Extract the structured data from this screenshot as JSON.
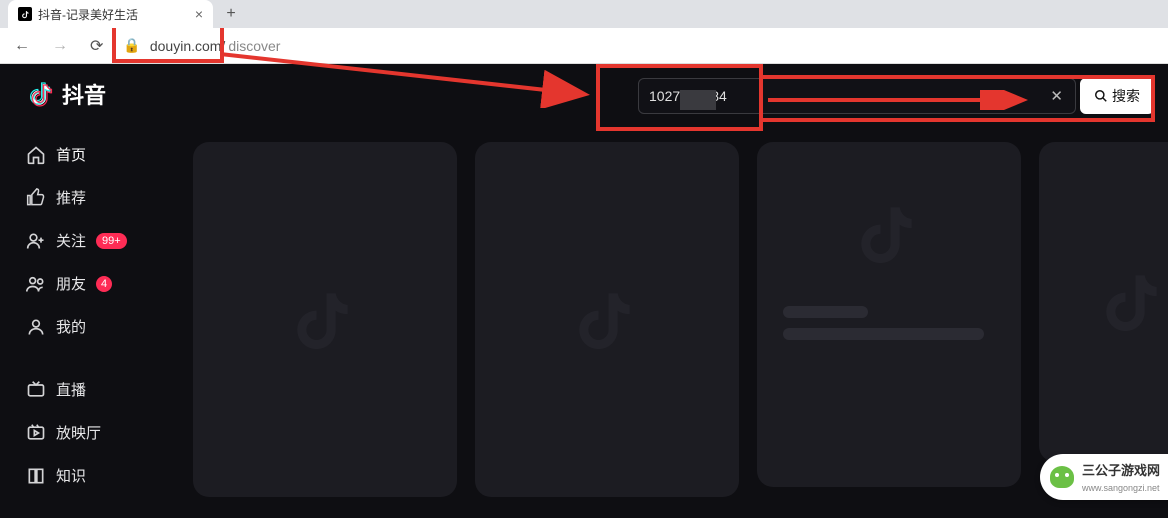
{
  "browser": {
    "tab_title": "抖音-记录美好生活",
    "url_domain": "douyin.com/",
    "url_path": "discover"
  },
  "app": {
    "logo_text": "抖音",
    "search_value_prefix": "1027",
    "search_value_suffix": "484",
    "search_button": "搜索"
  },
  "sidebar": {
    "items": [
      {
        "icon": "home",
        "label": "首页",
        "badge": null,
        "active": true
      },
      {
        "icon": "thumb",
        "label": "推荐",
        "badge": null
      },
      {
        "icon": "user-plus",
        "label": "关注",
        "badge": "99+"
      },
      {
        "icon": "people",
        "label": "朋友",
        "badge": "4",
        "badge_round": true
      },
      {
        "icon": "person",
        "label": "我的",
        "badge": null
      },
      {
        "sep": true
      },
      {
        "icon": "tv",
        "label": "直播",
        "badge": null
      },
      {
        "icon": "film",
        "label": "放映厅",
        "badge": null
      },
      {
        "icon": "book",
        "label": "知识",
        "badge": null
      }
    ]
  },
  "watermark": {
    "title": "三公子游戏网",
    "sub": "www.sangongzi.net"
  }
}
